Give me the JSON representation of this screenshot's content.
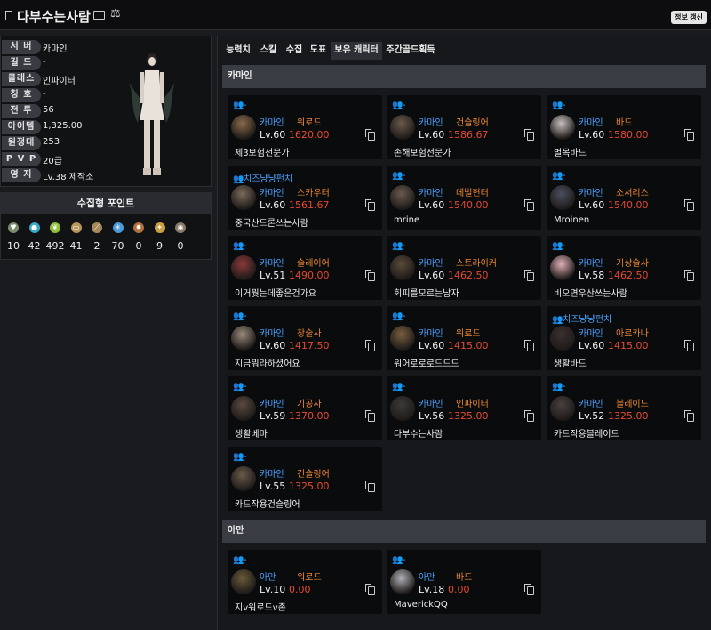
{
  "header": {
    "title": "다부수는사람",
    "refresh_label": "정보 갱신"
  },
  "profile": [
    {
      "label": "서 버",
      "value": "카마인"
    },
    {
      "label": "길 드",
      "value": "-"
    },
    {
      "label": "클래스",
      "value": "인파이터"
    },
    {
      "label": "칭 호",
      "value": "-"
    },
    {
      "label": "전 투",
      "value": "56"
    },
    {
      "label": "아이템",
      "value": "1,325.00"
    },
    {
      "label": "원정대",
      "value": "253"
    },
    {
      "label": "P V P",
      "value": "20급"
    },
    {
      "label": "영 지",
      "value": "Lv.38 제작소"
    }
  ],
  "collect": {
    "title": "수집형 포인트",
    "items": [
      {
        "icon": "island-heart-icon",
        "value": "10",
        "color": "#7a8a6a"
      },
      {
        "icon": "orb-icon",
        "value": "42",
        "color": "#3aa8c8"
      },
      {
        "icon": "seed-icon",
        "value": "492",
        "color": "#8fbf3a"
      },
      {
        "icon": "artwork-icon",
        "value": "41",
        "color": "#b8955a"
      },
      {
        "icon": "voyage-icon",
        "value": "2",
        "color": "#a88a5a"
      },
      {
        "icon": "leaf-icon",
        "value": "70",
        "color": "#4a9ad8"
      },
      {
        "icon": "ignea-icon",
        "value": "0",
        "color": "#b07040"
      },
      {
        "icon": "star-icon",
        "value": "9",
        "color": "#c8a040"
      },
      {
        "icon": "orgel-icon",
        "value": "0",
        "color": "#8a7a6a"
      }
    ]
  },
  "tabs": [
    "능력치",
    "스킬",
    "수집",
    "도표",
    "보유 캐릭터",
    "주간골드획득"
  ],
  "sections": [
    {
      "title": "카마인",
      "characters": [
        {
          "guild": "-",
          "server": "카마인",
          "class": "워로드",
          "level": "Lv.60",
          "ilvl": "1620.00",
          "name": "제3보험전문가"
        },
        {
          "guild": "-",
          "server": "카마인",
          "class": "건슬링어",
          "level": "Lv.60",
          "ilvl": "1586.67",
          "name": "손해보험전문가"
        },
        {
          "guild": "-",
          "server": "카마인",
          "class": "바드",
          "level": "Lv.60",
          "ilvl": "1580.00",
          "name": "별목바드"
        },
        {
          "guild": "치즈냥냥펀치",
          "server": "카마인",
          "class": "스카우터",
          "level": "Lv.60",
          "ilvl": "1561.67",
          "name": "중국산드론쓰는사람"
        },
        {
          "guild": "-",
          "server": "카마인",
          "class": "데빌헌터",
          "level": "Lv.60",
          "ilvl": "1540.00",
          "name": "mrine"
        },
        {
          "guild": "-",
          "server": "카마인",
          "class": "소서리스",
          "level": "Lv.60",
          "ilvl": "1540.00",
          "name": "Mroinen"
        },
        {
          "guild": "-",
          "server": "카마인",
          "class": "슬레이어",
          "level": "Lv.51",
          "ilvl": "1490.00",
          "name": "이거뭣는데좋은건가요"
        },
        {
          "guild": "-",
          "server": "카마인",
          "class": "스트라이커",
          "level": "Lv.60",
          "ilvl": "1462.50",
          "name": "회피를모르는남자"
        },
        {
          "guild": "-",
          "server": "카마인",
          "class": "기상술사",
          "level": "Lv.58",
          "ilvl": "1462.50",
          "name": "비오면우산쓰는사람"
        },
        {
          "guild": "-",
          "server": "카마인",
          "class": "창술사",
          "level": "Lv.60",
          "ilvl": "1417.50",
          "name": "지금뭐라하셨어요"
        },
        {
          "guild": "-",
          "server": "카마인",
          "class": "워로드",
          "level": "Lv.60",
          "ilvl": "1415.00",
          "name": "워어로로로드드드"
        },
        {
          "guild": "치즈냥냥펀치",
          "server": "카마인",
          "class": "아르카나",
          "level": "Lv.60",
          "ilvl": "1415.00",
          "name": "생활바드"
        },
        {
          "guild": "-",
          "server": "카마인",
          "class": "기공사",
          "level": "Lv.59",
          "ilvl": "1370.00",
          "name": "생활베마"
        },
        {
          "guild": "-",
          "server": "카마인",
          "class": "인파이터",
          "level": "Lv.56",
          "ilvl": "1325.00",
          "name": "다부수는사람"
        },
        {
          "guild": "-",
          "server": "카마인",
          "class": "블레이드",
          "level": "Lv.52",
          "ilvl": "1325.00",
          "name": "카드작용블레이드"
        },
        {
          "guild": "-",
          "server": "카마인",
          "class": "건슬링어",
          "level": "Lv.55",
          "ilvl": "1325.00",
          "name": "카드작용건슬링어"
        }
      ]
    },
    {
      "title": "아만",
      "characters": [
        {
          "guild": "-",
          "server": "아만",
          "class": "워로드",
          "level": "Lv.10",
          "ilvl": "0.00",
          "name": "지v워로드v존"
        },
        {
          "guild": "-",
          "server": "아만",
          "class": "바드",
          "level": "Lv.18",
          "ilvl": "0.00",
          "name": "MaverickQQ"
        }
      ]
    }
  ]
}
